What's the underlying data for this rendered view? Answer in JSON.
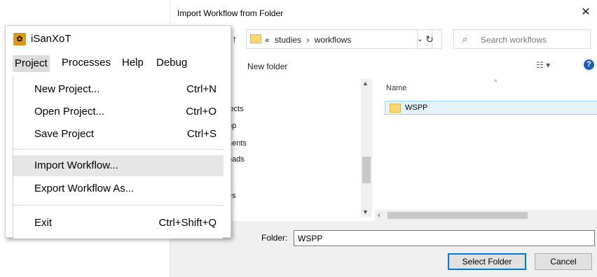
{
  "dialog": {
    "title": "Import Workflow from Folder",
    "close_icon": "close-icon",
    "breadcrumb": {
      "overflow": "«",
      "items": [
        "studies",
        "workflows"
      ],
      "separator": "›"
    },
    "search_placeholder": "Search workflows",
    "new_folder_label": "New folder",
    "nav_items": [
      "jects",
      "op",
      "nents",
      "oads",
      "es"
    ],
    "column_name": "Name",
    "files": [
      {
        "name": "WSPP",
        "type": "folder"
      }
    ],
    "folder_label": "Folder:",
    "folder_value": "WSPP",
    "select_button": "Select Folder",
    "cancel_button": "Cancel"
  },
  "app": {
    "name": "iSanXoT",
    "menubar": [
      "Project",
      "Processes",
      "Help",
      "Debug"
    ],
    "project_menu": [
      {
        "label": "New Project...",
        "shortcut": "Ctrl+N"
      },
      {
        "label": "Open Project...",
        "shortcut": "Ctrl+O"
      },
      {
        "label": "Save Project",
        "shortcut": "Ctrl+S"
      },
      {
        "label": "Import Workflow...",
        "shortcut": ""
      },
      {
        "label": "Export Workflow As...",
        "shortcut": ""
      },
      {
        "label": "Exit",
        "shortcut": "Ctrl+Shift+Q"
      }
    ]
  }
}
